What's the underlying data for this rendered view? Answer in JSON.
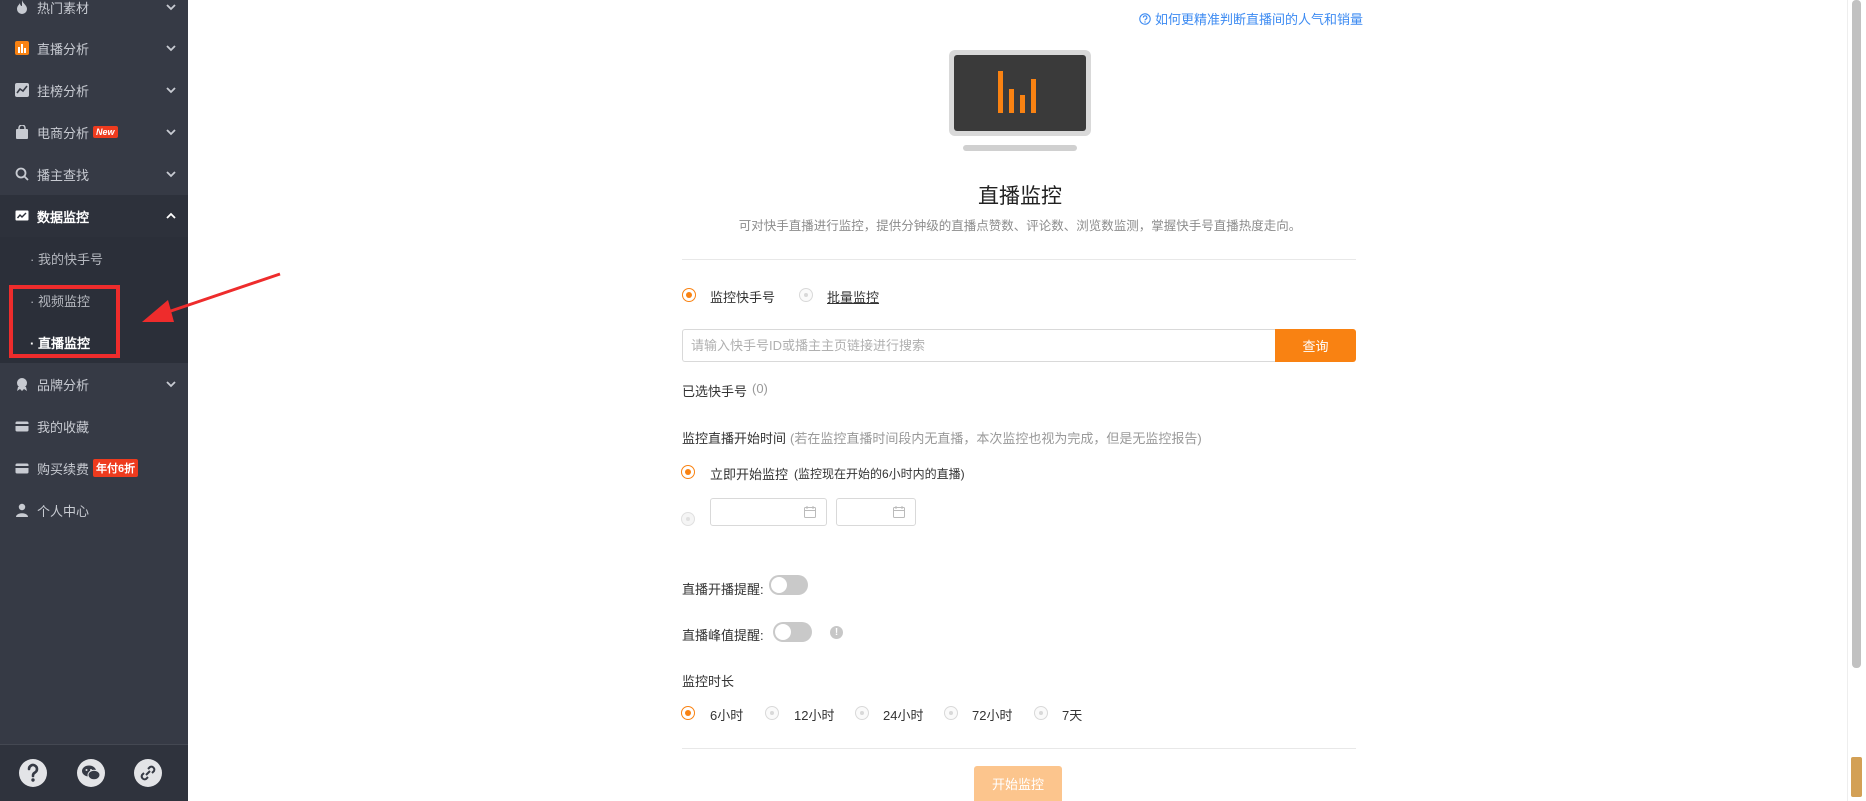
{
  "sidebar": {
    "items": [
      {
        "label": "热门素材"
      },
      {
        "label": "直播分析"
      },
      {
        "label": "挂榜分析"
      },
      {
        "label": "电商分析",
        "badge": "New"
      },
      {
        "label": "播主查找"
      },
      {
        "label": "数据监控"
      },
      {
        "label": "品牌分析"
      },
      {
        "label": "我的收藏"
      },
      {
        "label": "购买续费",
        "badge": "年付6折"
      },
      {
        "label": "个人中心"
      }
    ],
    "subitems": [
      {
        "label": "· 我的快手号"
      },
      {
        "label": "· 视频监控"
      },
      {
        "label": "· 直播监控"
      }
    ]
  },
  "main": {
    "help_link": "如何更精准判断直播间的人气和销量",
    "title": "直播监控",
    "description": "可对快手直播进行监控，提供分钟级的直播点赞数、评论数、浏览数监测，掌握快手号直播热度走向。",
    "mode_options": [
      "监控快手号",
      "批量监控"
    ],
    "search_placeholder": "请输入快手号ID或播主主页链接进行搜索",
    "search_button": "查询",
    "selected_label": "已选快手号",
    "selected_count": "(0)",
    "start_time_label": "监控直播开始时间",
    "start_time_note": "(若在监控直播时间段内无直播，本次监控也视为完成，但是无监控报告)",
    "start_now": "立即开始监控",
    "start_now_note": "(监控现在开始的6小时内的直播)",
    "live_start_reminder": "直播开播提醒:",
    "peak_reminder": "直播峰值提醒:",
    "duration_label": "监控时长",
    "duration_options": [
      "6小时",
      "12小时",
      "24小时",
      "72小时",
      "7天"
    ],
    "start_button": "开始监控"
  },
  "colors": {
    "accent": "#f98212",
    "sidebar_bg": "#363a45",
    "link": "#3d8bf2",
    "annotation": "#ee2c2c"
  }
}
